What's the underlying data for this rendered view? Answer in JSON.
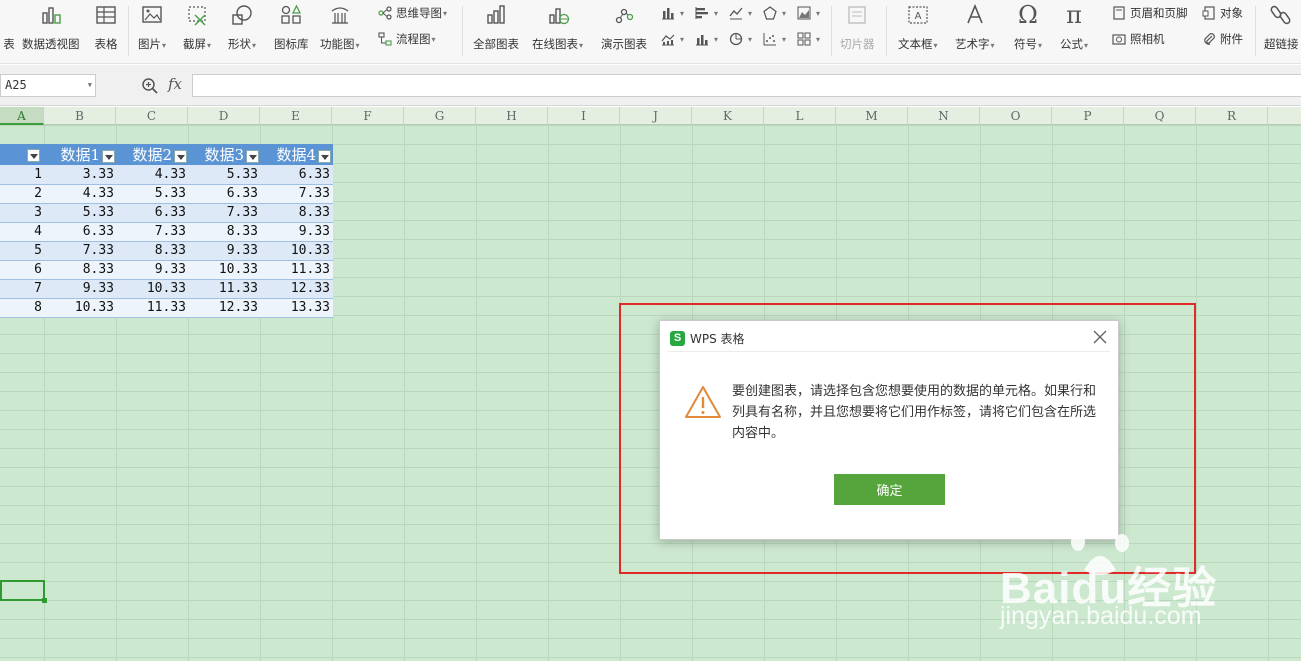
{
  "ribbon": {
    "edge_label": "表",
    "pivot_chart": "数据透视图",
    "table": "表格",
    "picture": "图片",
    "screenshot": "截屏",
    "shape": "形状",
    "icon_lib": "图标库",
    "function_chart": "功能图",
    "mindmap": "思维导图",
    "flowchart": "流程图",
    "all_charts": "全部图表",
    "online_chart": "在线图表",
    "demo_chart": "演示图表",
    "slicer": "切片器",
    "textbox": "文本框",
    "wordart": "艺术字",
    "symbol": "符号",
    "formula": "公式",
    "header_footer": "页眉和页脚",
    "object": "对象",
    "camera": "照相机",
    "attachment": "附件",
    "hyperlink": "超链接"
  },
  "formula_bar": {
    "name_box": "A25",
    "fx_label": "fx",
    "formula_value": ""
  },
  "columns": [
    "A",
    "B",
    "C",
    "D",
    "E",
    "F",
    "G",
    "H",
    "I",
    "J",
    "K",
    "L",
    "M",
    "N",
    "O",
    "P",
    "Q",
    "R"
  ],
  "table": {
    "headers": [
      "数据1",
      "数据2",
      "数据3",
      "数据4"
    ],
    "rows": [
      [
        "1",
        "3.33",
        "4.33",
        "5.33",
        "6.33"
      ],
      [
        "2",
        "4.33",
        "5.33",
        "6.33",
        "7.33"
      ],
      [
        "3",
        "5.33",
        "6.33",
        "7.33",
        "8.33"
      ],
      [
        "4",
        "6.33",
        "7.33",
        "8.33",
        "9.33"
      ],
      [
        "5",
        "7.33",
        "8.33",
        "9.33",
        "10.33"
      ],
      [
        "6",
        "8.33",
        "9.33",
        "10.33",
        "11.33"
      ],
      [
        "7",
        "9.33",
        "10.33",
        "11.33",
        "12.33"
      ],
      [
        "8",
        "10.33",
        "11.33",
        "12.33",
        "13.33"
      ]
    ]
  },
  "dialog": {
    "title": "WPS 表格",
    "message": "要创建图表，请选择包含您想要使用的数据的单元格。如果行和列具有名称，并且您想要将它们用作标签，请将它们包含在所选内容中。",
    "ok_label": "确定"
  },
  "watermark": {
    "brand": "Baidu经验",
    "url": "jingyan.baidu.com"
  },
  "colors": {
    "sheet_bg": "#cce8cf",
    "table_header": "#5b94d4",
    "ok_button": "#56a43c",
    "highlight": "#e02a2a"
  }
}
